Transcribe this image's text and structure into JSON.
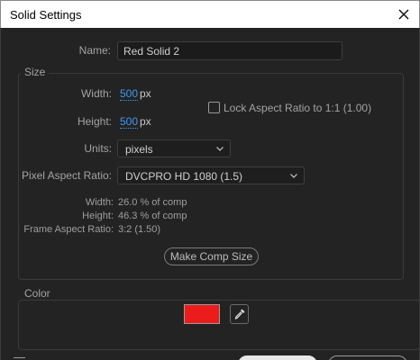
{
  "window": {
    "title": "Solid Settings"
  },
  "name": {
    "label": "Name:",
    "value": "Red Solid 2"
  },
  "size": {
    "group_label": "Size",
    "width_label": "Width:",
    "width_value": "500",
    "width_unit": "px",
    "height_label": "Height:",
    "height_value": "500",
    "height_unit": "px",
    "lock_label": "Lock Aspect Ratio to 1:1 (1.00)",
    "lock_checked": false,
    "units_label": "Units:",
    "units_value": "pixels",
    "par_label": "Pixel Aspect Ratio:",
    "par_value": "DVCPRO HD 1080 (1.5)",
    "info": {
      "width_label": "Width:",
      "width_value": "26.0 % of comp",
      "height_label": "Height:",
      "height_value": "46.3 % of comp",
      "far_label": "Frame Aspect Ratio:",
      "far_value": "3:2 (1.50)"
    },
    "make_comp_size_label": "Make Comp Size"
  },
  "color": {
    "group_label": "Color",
    "swatch_hex": "#ed1c1c"
  },
  "theme": {
    "accent": "#3e9bf0",
    "background": "#232323"
  },
  "icons": {
    "close": "close-icon",
    "chevron": "chevron-down-icon",
    "eyedropper": "eyedropper-icon"
  }
}
